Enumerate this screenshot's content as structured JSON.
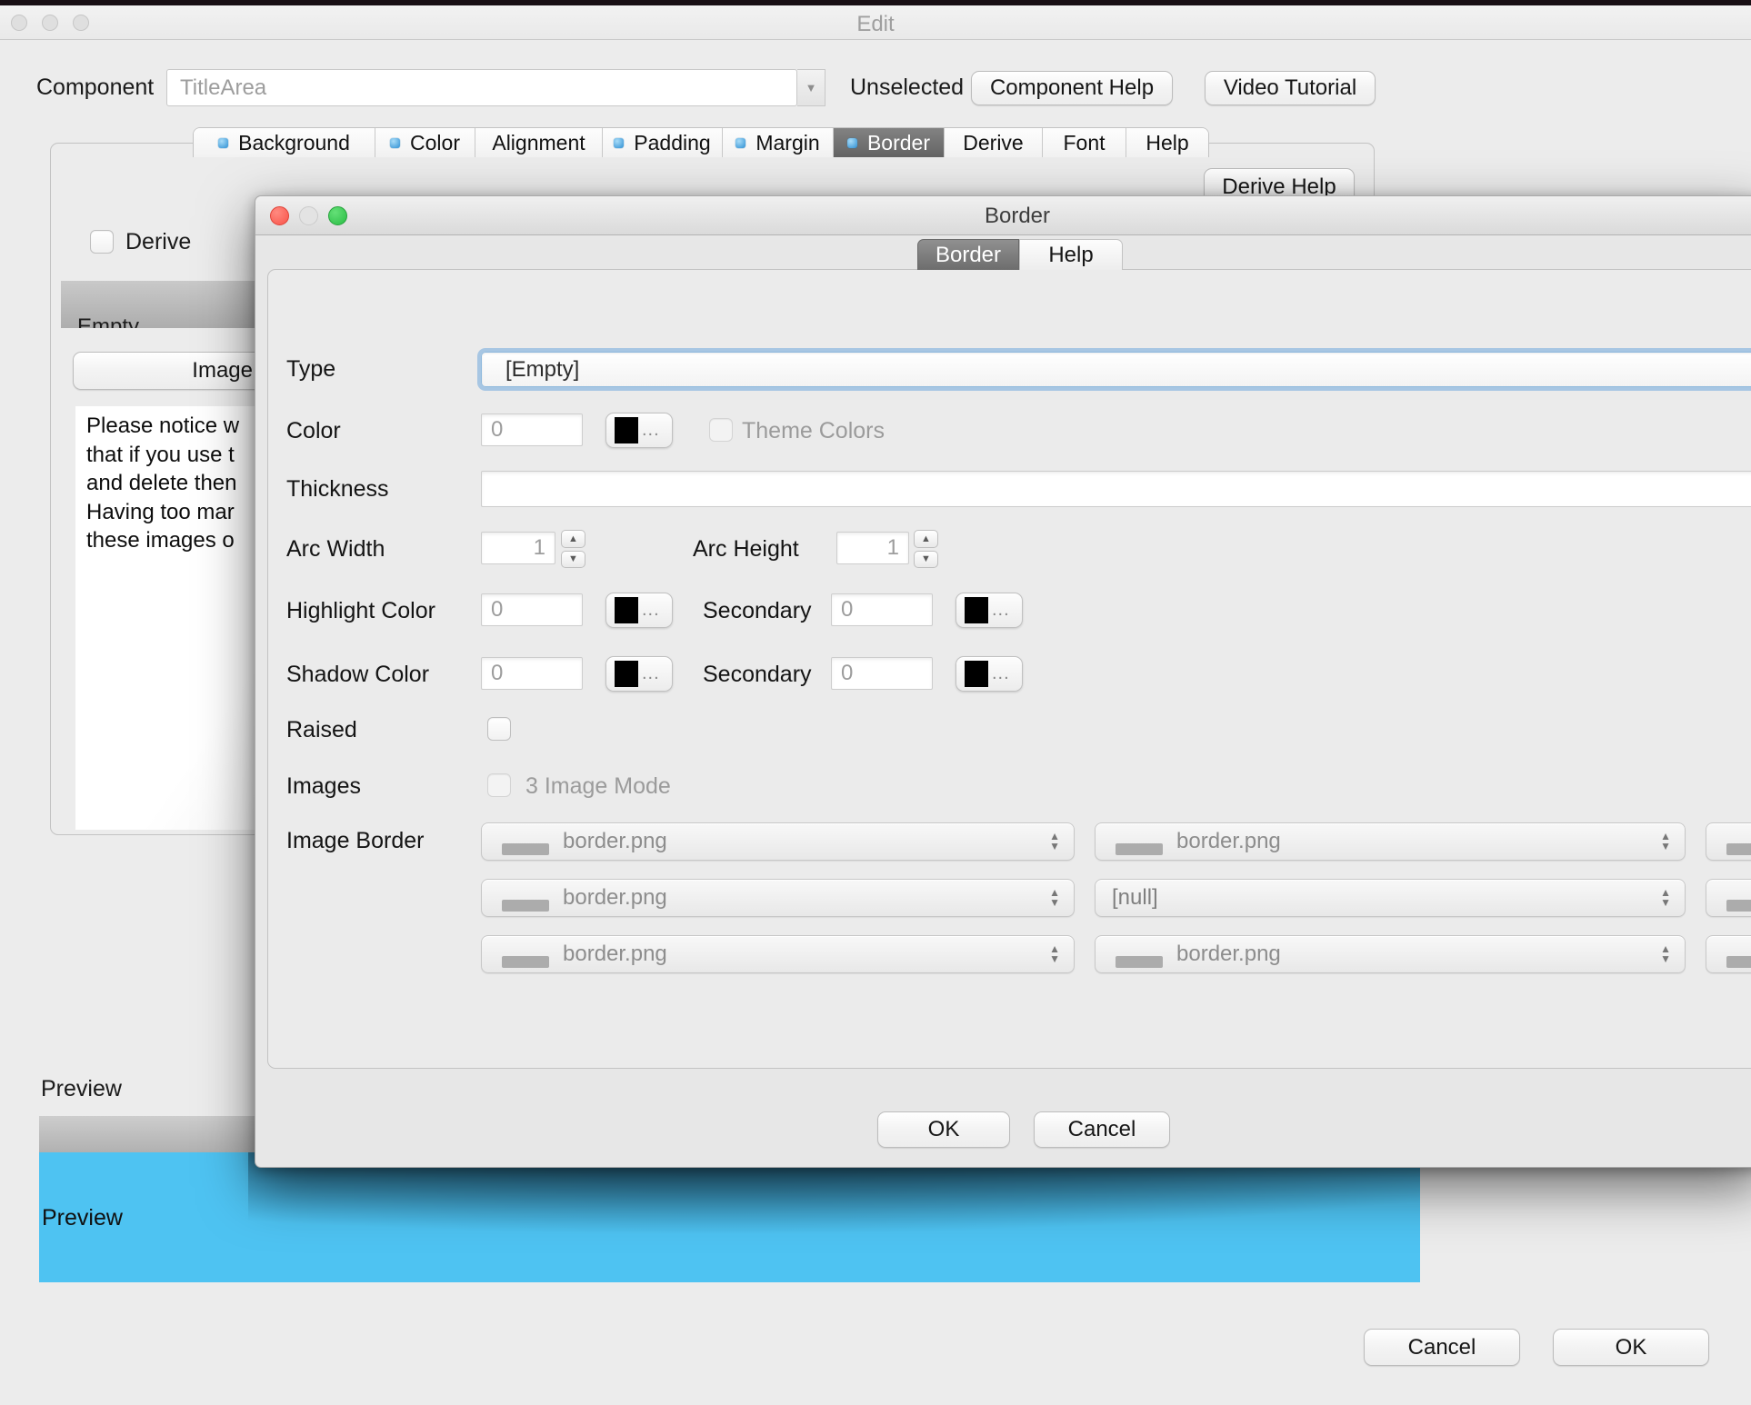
{
  "window": {
    "title": "Edit"
  },
  "component_bar": {
    "label": "Component",
    "value": "TitleArea",
    "status": "Unselected",
    "help_button": "Component Help",
    "tutorial_button": "Video Tutorial"
  },
  "main_tabs": {
    "items": [
      {
        "label": "Background"
      },
      {
        "label": "Color"
      },
      {
        "label": "Alignment"
      },
      {
        "label": "Padding"
      },
      {
        "label": "Margin"
      },
      {
        "label": "Border"
      },
      {
        "label": "Derive"
      },
      {
        "label": "Font"
      },
      {
        "label": "Help"
      }
    ]
  },
  "border_tab_panel": {
    "derive_label": "Derive",
    "combo_fragment": "Empty",
    "image_border_button": "Image Borde",
    "notice_lines": [
      "Please notice w",
      "that if you use t",
      "and delete then",
      "Having too mar",
      "these images o"
    ],
    "derive_help_button": "Derive Help"
  },
  "dialog": {
    "title": "Border",
    "tabs": {
      "border": "Border",
      "help": "Help"
    },
    "type": {
      "label": "Type",
      "value": "[Empty]"
    },
    "color": {
      "label": "Color",
      "value": "0",
      "ellipsis": "...",
      "theme_label": "Theme Colors"
    },
    "thickness": {
      "label": "Thickness",
      "value": ""
    },
    "arc": {
      "width_label": "Arc Width",
      "width_value": "1",
      "height_label": "Arc Height",
      "height_value": "1"
    },
    "highlight": {
      "label": "Highlight Color",
      "value": "0",
      "secondary_label": "Secondary",
      "secondary_value": "0"
    },
    "shadow": {
      "label": "Shadow Color",
      "value": "0",
      "secondary_label": "Secondary",
      "secondary_value": "0"
    },
    "raised": {
      "label": "Raised"
    },
    "images": {
      "label": "Images",
      "mode_label": "3 Image Mode"
    },
    "image_border": {
      "label": "Image Border",
      "rows": [
        {
          "cells": [
            {
              "label": "border.png"
            },
            {
              "label": "border.png"
            },
            {
              "label": ""
            }
          ]
        },
        {
          "cells": [
            {
              "label": "border.png"
            },
            {
              "label": "[null]"
            },
            {
              "label": ""
            }
          ]
        },
        {
          "cells": [
            {
              "label": "border.png"
            },
            {
              "label": "border.png"
            },
            {
              "label": ""
            }
          ]
        }
      ]
    },
    "ok_button": "OK",
    "cancel_button": "Cancel"
  },
  "preview": {
    "section_label": "Preview",
    "content_label": "Preview"
  },
  "footer": {
    "cancel_button": "Cancel",
    "ok_button": "OK"
  },
  "colors": {
    "preview_blue": "#4ec3f2",
    "preview_bar": "#bdbdbd",
    "tab_dot": "#3fa9e8",
    "selected_tab": "#6f6f6f",
    "traffic_red": "#fb5f57",
    "traffic_green": "#32c74e",
    "focus_ring": "#7ab0dd"
  }
}
